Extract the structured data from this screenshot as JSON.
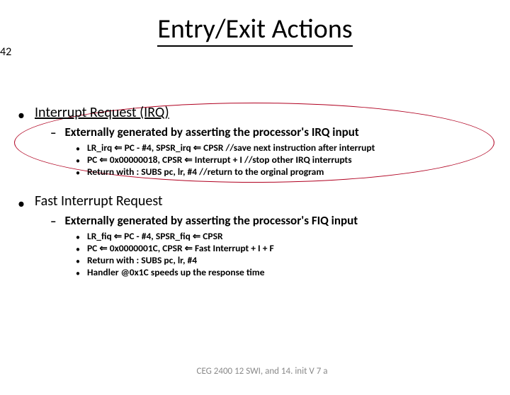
{
  "title": "Entry/Exit Actions",
  "bullets": [
    {
      "label": "Interrupt Request (IRQ)",
      "sub": {
        "label": "Externally generated by asserting the processor's IRQ input",
        "items": [
          "LR_irq ⇐ PC - #4, SPSR_irq ⇐ CPSR   //save next instruction after interrupt",
          "PC ⇐ 0x00000018, CPSR ⇐ Interrupt + I   //stop other IRQ interrupts",
          "Return with : SUBS pc, lr, #4    //return to the orginal program"
        ]
      }
    },
    {
      "label": "Fast Interrupt Request",
      "sub": {
        "label": "Externally generated by asserting the processor's FIQ input",
        "items": [
          "LR_fiq ⇐ PC - #4, SPSR_fiq ⇐ CPSR",
          "PC ⇐ 0x0000001C, CPSR ⇐ Fast Interrupt + I + F",
          "Return with : SUBS pc, lr, #4",
          "Handler @0x1C speeds up the response time"
        ]
      }
    }
  ],
  "footer": {
    "text": "CEG 2400 12 SWI, and 14. init V 7 a",
    "page": "42"
  }
}
